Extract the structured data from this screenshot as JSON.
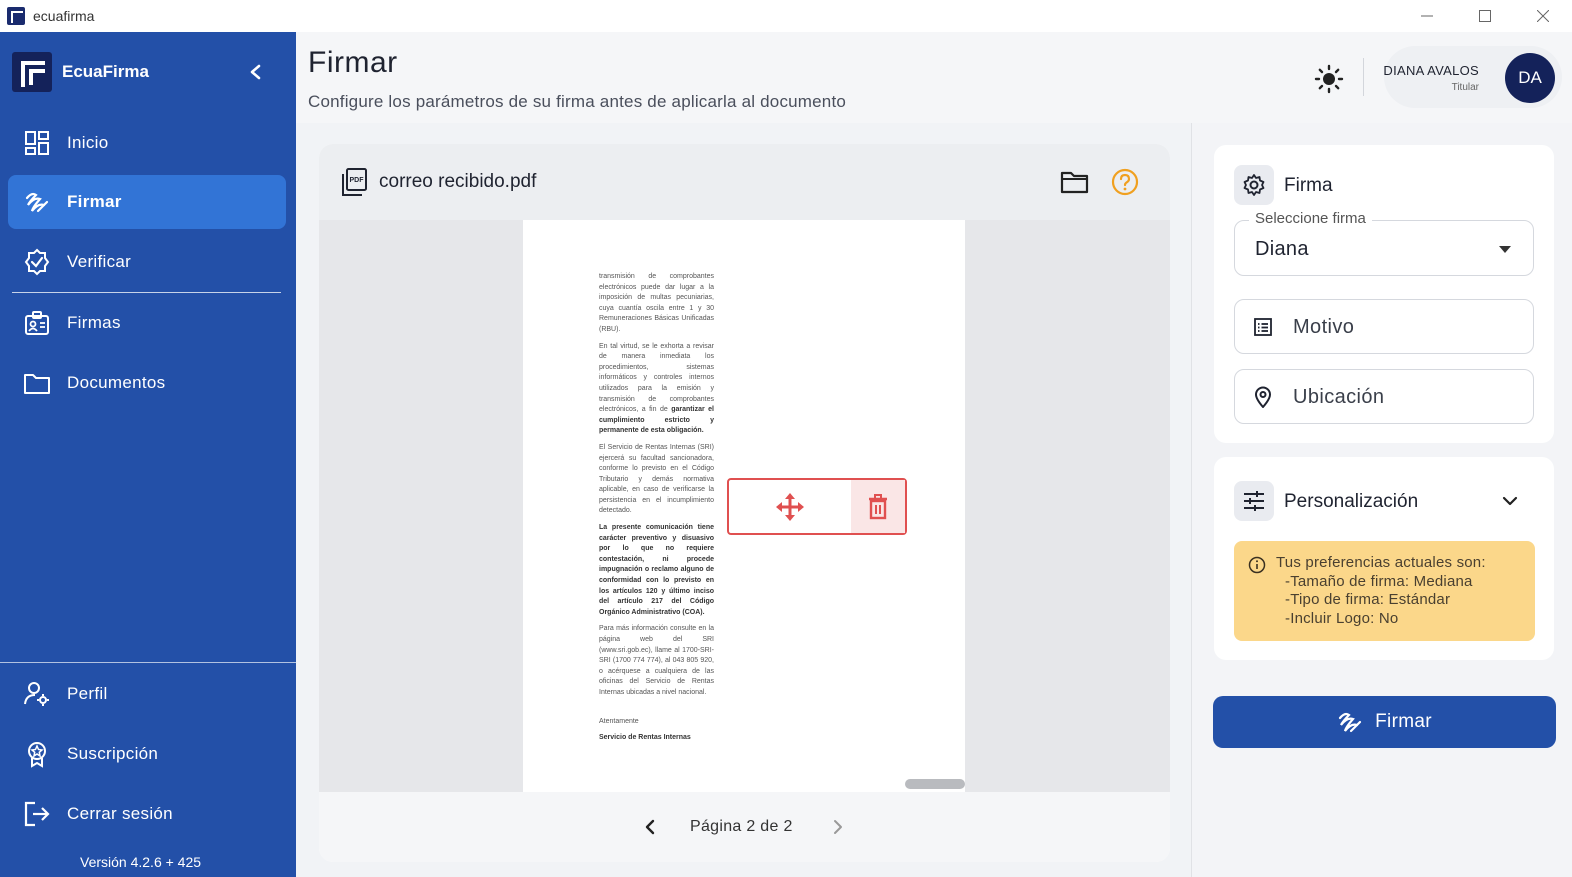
{
  "window": {
    "title": "ecuafirma",
    "minimize_glyph": "—",
    "maximize_glyph": "☐",
    "close_glyph": "✕"
  },
  "sidebar": {
    "brand": "EcuaFirma",
    "items": [
      {
        "label": "Inicio",
        "icon": "dashboard-icon"
      },
      {
        "label": "Firmar",
        "icon": "signature-icon",
        "active": true
      },
      {
        "label": "Verificar",
        "icon": "verified-badge-icon"
      },
      {
        "label": "Firmas",
        "icon": "id-badge-icon"
      },
      {
        "label": "Documentos",
        "icon": "folder-icon"
      }
    ],
    "bottom_items": [
      {
        "label": "Perfil",
        "icon": "user-settings-icon"
      },
      {
        "label": "Suscripción",
        "icon": "award-icon"
      },
      {
        "label": "Cerrar sesión",
        "icon": "logout-icon"
      }
    ],
    "version": "Versión 4.2.6 + 425"
  },
  "header": {
    "title": "Firmar",
    "subtitle": "Configure los parámetros de su firma antes de aplicarla al documento",
    "user": {
      "name": "DIANA AVALOS",
      "role": "Titular",
      "initials": "DA"
    }
  },
  "document": {
    "filename": "correo recibido.pdf",
    "page_paragraphs": [
      "transmisión de comprobantes electrónicos puede dar lugar a la imposición de multas pecuniarias, cuya cuantía oscila entre 1 y 30 Remuneraciones Básicas Unificadas (RBU).",
      "En tal virtud, se le exhorta a revisar de manera inmediata los procedimientos, sistemas informáticos y controles internos utilizados para la emisión y transmisión de comprobantes electrónicos, a fin de",
      "garantizar el cumplimiento estricto y permanente de esta obligación.",
      "El Servicio de Rentas Internas (SRI) ejercerá su facultad sancionadora, conforme lo previsto en el Código Tributario y demás normativa aplicable, en caso de verificarse la persistencia en el incumplimiento detectado.",
      "La presente comunicación tiene carácter preventivo y disuasivo por lo que no requiere contestación, ni procede impugnación o reclamo alguno de conformidad con lo previsto en los artículos 120 y último inciso del artículo 217 del Código Orgánico Administrativo (COA).",
      "Para más información consulte en la página web del SRI (www.sri.gob.ec), llame al 1700-SRI-SRI (1700 774 774), al 043 805 920, o acérquese a cualquiera de las oficinas del Servicio de Rentas Internas ubicadas a nivel nacional.",
      "Atentamente",
      "Servicio de Rentas Internas"
    ],
    "pager_label": "Página 2 de 2"
  },
  "firma_panel": {
    "title": "Firma",
    "select_legend": "Seleccione firma",
    "selected_signature": "Diana",
    "motivo_placeholder": "Motivo",
    "ubicacion_placeholder": "Ubicación"
  },
  "personalizacion": {
    "title": "Personalización",
    "intro": "Tus preferencias actuales son:",
    "lines": [
      "-Tamaño de firma: Mediana",
      "-Tipo de firma: Estándar",
      "-Incluir Logo: No"
    ]
  },
  "sign_button_label": "Firmar",
  "colors": {
    "sidebar": "#2350a8",
    "sidebar_active": "#3274d6",
    "primary_button": "#2350a8",
    "pref_box": "#fbd78a",
    "signature_box_border": "#e05050",
    "help_icon": "#f0a020"
  }
}
